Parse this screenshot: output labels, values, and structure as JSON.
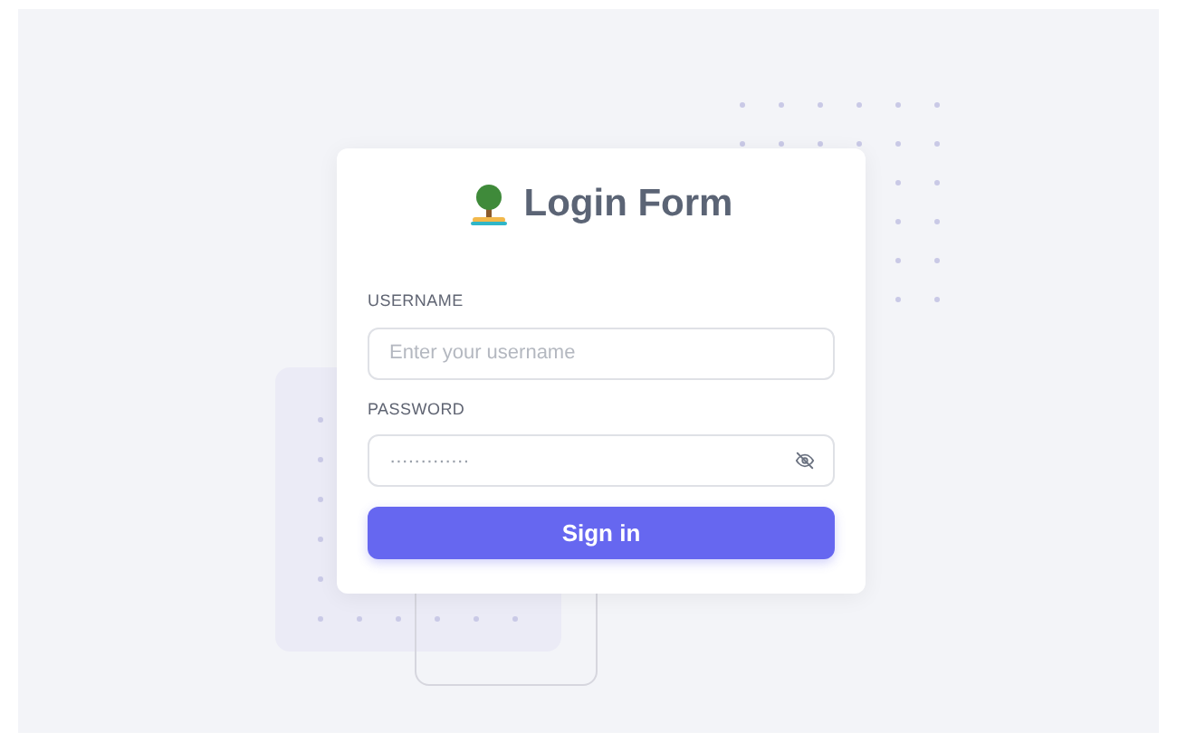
{
  "form": {
    "title": "Login Form",
    "fields": [
      {
        "label": "USERNAME",
        "kind": "text",
        "placeholder": "Enter your username"
      },
      {
        "label": "PASSWORD",
        "kind": "password",
        "value": "·············"
      }
    ],
    "submit": "Sign in"
  }
}
